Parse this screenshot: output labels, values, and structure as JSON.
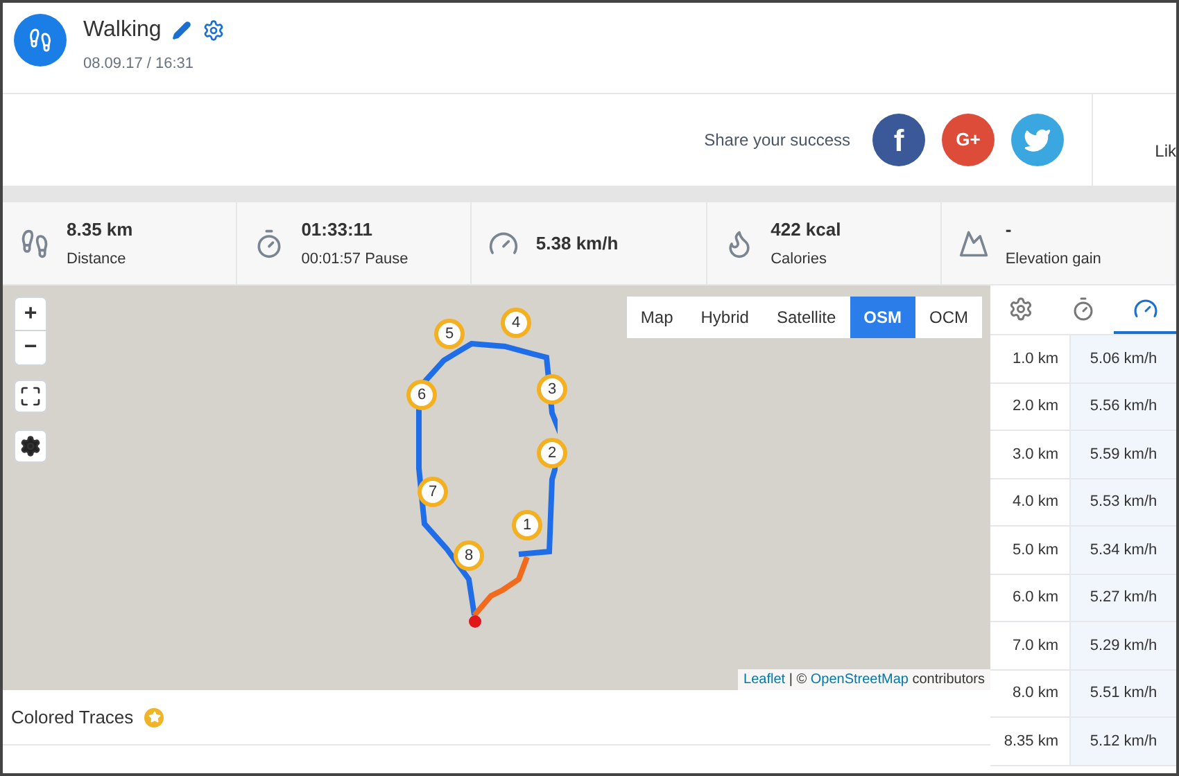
{
  "activity": {
    "title": "Walking",
    "datetime": "08.09.17 / 16:31"
  },
  "share": {
    "label": "Share your success",
    "networks": [
      {
        "kind": "facebook",
        "glyph": "f"
      },
      {
        "kind": "google",
        "glyph": "G+"
      },
      {
        "kind": "twitter"
      }
    ],
    "side_label": "Lik"
  },
  "stats": [
    {
      "kind": "distance",
      "value": "8.35 km",
      "label": "Distance"
    },
    {
      "kind": "duration",
      "value": "01:33:11",
      "label": "00:01:57 Pause"
    },
    {
      "kind": "speed",
      "value": "5.38 km/h"
    },
    {
      "kind": "calories",
      "value": "422 kcal",
      "label": "Calories"
    },
    {
      "kind": "elevation",
      "value": "-",
      "label": "Elevation gain"
    }
  ],
  "map": {
    "zoom_in": "+",
    "zoom_out": "−",
    "layers": [
      {
        "label": "Map",
        "selected": false
      },
      {
        "label": "Hybrid",
        "selected": false
      },
      {
        "label": "Satellite",
        "selected": false
      },
      {
        "label": "OSM",
        "selected": true
      },
      {
        "label": "OCM",
        "selected": false
      }
    ],
    "markers": [
      "1",
      "2",
      "3",
      "4",
      "5",
      "6",
      "7",
      "8"
    ],
    "attribution": {
      "link1": "Leaflet",
      "separator": "| ©",
      "link2": "OpenStreetMap",
      "suffix": "contributors"
    }
  },
  "colored_traces": {
    "label": "Colored Traces"
  },
  "splits": {
    "tabs": [
      {
        "kind": "settings",
        "selected": false
      },
      {
        "kind": "time",
        "selected": false
      },
      {
        "kind": "speed",
        "selected": true
      }
    ],
    "rows": [
      {
        "distance": "1.0 km",
        "speed": "5.06 km/h"
      },
      {
        "distance": "2.0 km",
        "speed": "5.56 km/h"
      },
      {
        "distance": "3.0 km",
        "speed": "5.59 km/h"
      },
      {
        "distance": "4.0 km",
        "speed": "5.53 km/h"
      },
      {
        "distance": "5.0 km",
        "speed": "5.34 km/h"
      },
      {
        "distance": "6.0 km",
        "speed": "5.27 km/h"
      },
      {
        "distance": "7.0 km",
        "speed": "5.29 km/h"
      },
      {
        "distance": "8.0 km",
        "speed": "5.51 km/h"
      },
      {
        "distance": "8.35 km",
        "speed": "5.12 km/h"
      }
    ]
  }
}
